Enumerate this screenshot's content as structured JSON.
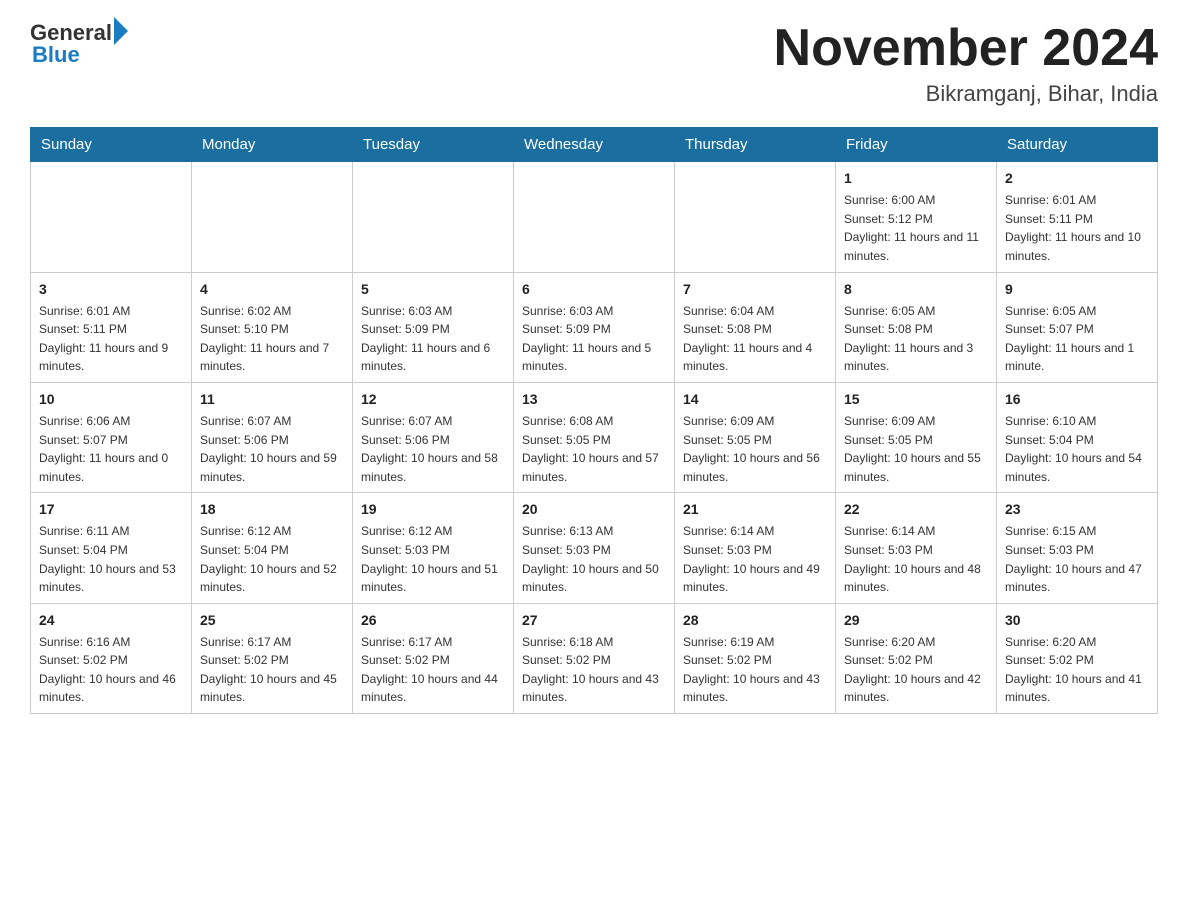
{
  "header": {
    "logo_text_general": "General",
    "logo_text_blue": "Blue",
    "month_year": "November 2024",
    "location": "Bikramganj, Bihar, India"
  },
  "weekdays": [
    "Sunday",
    "Monday",
    "Tuesday",
    "Wednesday",
    "Thursday",
    "Friday",
    "Saturday"
  ],
  "weeks": [
    [
      {
        "day": "",
        "sunrise": "",
        "sunset": "",
        "daylight": ""
      },
      {
        "day": "",
        "sunrise": "",
        "sunset": "",
        "daylight": ""
      },
      {
        "day": "",
        "sunrise": "",
        "sunset": "",
        "daylight": ""
      },
      {
        "day": "",
        "sunrise": "",
        "sunset": "",
        "daylight": ""
      },
      {
        "day": "",
        "sunrise": "",
        "sunset": "",
        "daylight": ""
      },
      {
        "day": "1",
        "sunrise": "Sunrise: 6:00 AM",
        "sunset": "Sunset: 5:12 PM",
        "daylight": "Daylight: 11 hours and 11 minutes."
      },
      {
        "day": "2",
        "sunrise": "Sunrise: 6:01 AM",
        "sunset": "Sunset: 5:11 PM",
        "daylight": "Daylight: 11 hours and 10 minutes."
      }
    ],
    [
      {
        "day": "3",
        "sunrise": "Sunrise: 6:01 AM",
        "sunset": "Sunset: 5:11 PM",
        "daylight": "Daylight: 11 hours and 9 minutes."
      },
      {
        "day": "4",
        "sunrise": "Sunrise: 6:02 AM",
        "sunset": "Sunset: 5:10 PM",
        "daylight": "Daylight: 11 hours and 7 minutes."
      },
      {
        "day": "5",
        "sunrise": "Sunrise: 6:03 AM",
        "sunset": "Sunset: 5:09 PM",
        "daylight": "Daylight: 11 hours and 6 minutes."
      },
      {
        "day": "6",
        "sunrise": "Sunrise: 6:03 AM",
        "sunset": "Sunset: 5:09 PM",
        "daylight": "Daylight: 11 hours and 5 minutes."
      },
      {
        "day": "7",
        "sunrise": "Sunrise: 6:04 AM",
        "sunset": "Sunset: 5:08 PM",
        "daylight": "Daylight: 11 hours and 4 minutes."
      },
      {
        "day": "8",
        "sunrise": "Sunrise: 6:05 AM",
        "sunset": "Sunset: 5:08 PM",
        "daylight": "Daylight: 11 hours and 3 minutes."
      },
      {
        "day": "9",
        "sunrise": "Sunrise: 6:05 AM",
        "sunset": "Sunset: 5:07 PM",
        "daylight": "Daylight: 11 hours and 1 minute."
      }
    ],
    [
      {
        "day": "10",
        "sunrise": "Sunrise: 6:06 AM",
        "sunset": "Sunset: 5:07 PM",
        "daylight": "Daylight: 11 hours and 0 minutes."
      },
      {
        "day": "11",
        "sunrise": "Sunrise: 6:07 AM",
        "sunset": "Sunset: 5:06 PM",
        "daylight": "Daylight: 10 hours and 59 minutes."
      },
      {
        "day": "12",
        "sunrise": "Sunrise: 6:07 AM",
        "sunset": "Sunset: 5:06 PM",
        "daylight": "Daylight: 10 hours and 58 minutes."
      },
      {
        "day": "13",
        "sunrise": "Sunrise: 6:08 AM",
        "sunset": "Sunset: 5:05 PM",
        "daylight": "Daylight: 10 hours and 57 minutes."
      },
      {
        "day": "14",
        "sunrise": "Sunrise: 6:09 AM",
        "sunset": "Sunset: 5:05 PM",
        "daylight": "Daylight: 10 hours and 56 minutes."
      },
      {
        "day": "15",
        "sunrise": "Sunrise: 6:09 AM",
        "sunset": "Sunset: 5:05 PM",
        "daylight": "Daylight: 10 hours and 55 minutes."
      },
      {
        "day": "16",
        "sunrise": "Sunrise: 6:10 AM",
        "sunset": "Sunset: 5:04 PM",
        "daylight": "Daylight: 10 hours and 54 minutes."
      }
    ],
    [
      {
        "day": "17",
        "sunrise": "Sunrise: 6:11 AM",
        "sunset": "Sunset: 5:04 PM",
        "daylight": "Daylight: 10 hours and 53 minutes."
      },
      {
        "day": "18",
        "sunrise": "Sunrise: 6:12 AM",
        "sunset": "Sunset: 5:04 PM",
        "daylight": "Daylight: 10 hours and 52 minutes."
      },
      {
        "day": "19",
        "sunrise": "Sunrise: 6:12 AM",
        "sunset": "Sunset: 5:03 PM",
        "daylight": "Daylight: 10 hours and 51 minutes."
      },
      {
        "day": "20",
        "sunrise": "Sunrise: 6:13 AM",
        "sunset": "Sunset: 5:03 PM",
        "daylight": "Daylight: 10 hours and 50 minutes."
      },
      {
        "day": "21",
        "sunrise": "Sunrise: 6:14 AM",
        "sunset": "Sunset: 5:03 PM",
        "daylight": "Daylight: 10 hours and 49 minutes."
      },
      {
        "day": "22",
        "sunrise": "Sunrise: 6:14 AM",
        "sunset": "Sunset: 5:03 PM",
        "daylight": "Daylight: 10 hours and 48 minutes."
      },
      {
        "day": "23",
        "sunrise": "Sunrise: 6:15 AM",
        "sunset": "Sunset: 5:03 PM",
        "daylight": "Daylight: 10 hours and 47 minutes."
      }
    ],
    [
      {
        "day": "24",
        "sunrise": "Sunrise: 6:16 AM",
        "sunset": "Sunset: 5:02 PM",
        "daylight": "Daylight: 10 hours and 46 minutes."
      },
      {
        "day": "25",
        "sunrise": "Sunrise: 6:17 AM",
        "sunset": "Sunset: 5:02 PM",
        "daylight": "Daylight: 10 hours and 45 minutes."
      },
      {
        "day": "26",
        "sunrise": "Sunrise: 6:17 AM",
        "sunset": "Sunset: 5:02 PM",
        "daylight": "Daylight: 10 hours and 44 minutes."
      },
      {
        "day": "27",
        "sunrise": "Sunrise: 6:18 AM",
        "sunset": "Sunset: 5:02 PM",
        "daylight": "Daylight: 10 hours and 43 minutes."
      },
      {
        "day": "28",
        "sunrise": "Sunrise: 6:19 AM",
        "sunset": "Sunset: 5:02 PM",
        "daylight": "Daylight: 10 hours and 43 minutes."
      },
      {
        "day": "29",
        "sunrise": "Sunrise: 6:20 AM",
        "sunset": "Sunset: 5:02 PM",
        "daylight": "Daylight: 10 hours and 42 minutes."
      },
      {
        "day": "30",
        "sunrise": "Sunrise: 6:20 AM",
        "sunset": "Sunset: 5:02 PM",
        "daylight": "Daylight: 10 hours and 41 minutes."
      }
    ]
  ]
}
